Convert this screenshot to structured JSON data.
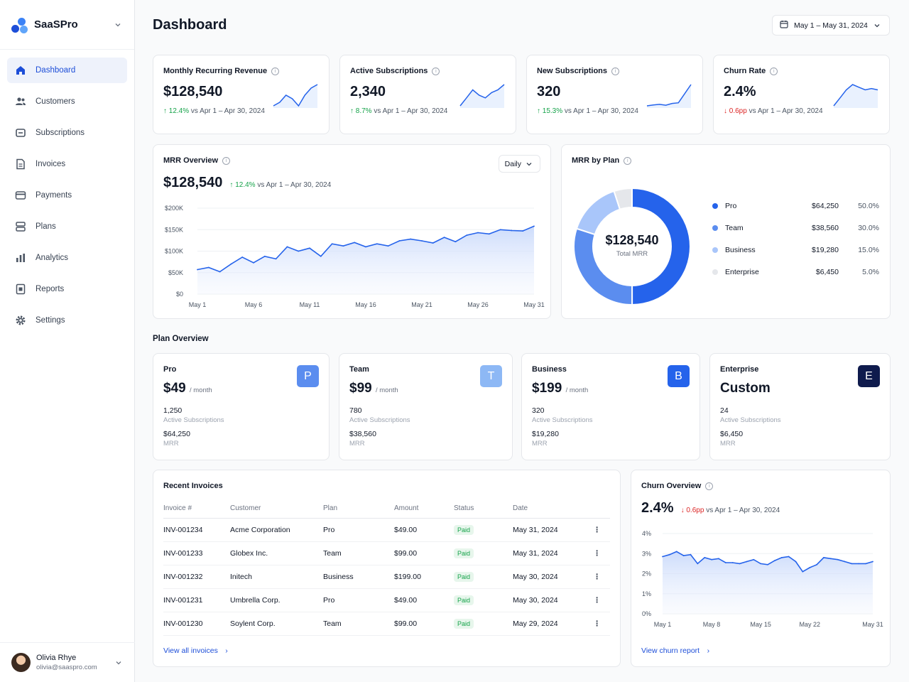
{
  "app": {
    "name": "SaaSPro"
  },
  "sidebar": {
    "items": [
      {
        "label": "Dashboard",
        "icon": "home-icon"
      },
      {
        "label": "Customers",
        "icon": "users-icon"
      },
      {
        "label": "Subscriptions",
        "icon": "subscription-icon"
      },
      {
        "label": "Invoices",
        "icon": "document-icon"
      },
      {
        "label": "Payments",
        "icon": "credit-card-icon"
      },
      {
        "label": "Plans",
        "icon": "plans-icon"
      },
      {
        "label": "Analytics",
        "icon": "bar-chart-icon"
      },
      {
        "label": "Reports",
        "icon": "report-icon"
      },
      {
        "label": "Settings",
        "icon": "gear-icon"
      }
    ],
    "user": {
      "name": "Olivia Rhye",
      "email": "olivia@saaspro.com"
    }
  },
  "header": {
    "title": "Dashboard",
    "date_range": "May 1 – May 31, 2024"
  },
  "kpis": [
    {
      "title": "Monthly Recurring Revenue",
      "value": "$128,540",
      "delta": "12.4%",
      "dir": "up",
      "compare": "vs Apr 1 – Apr 30, 2024"
    },
    {
      "title": "Active Subscriptions",
      "value": "2,340",
      "delta": "8.7%",
      "dir": "up",
      "compare": "vs Apr 1 – Apr 30, 2024"
    },
    {
      "title": "New Subscriptions",
      "value": "320",
      "delta": "15.3%",
      "dir": "up",
      "compare": "vs Apr 1 – Apr 30, 2024"
    },
    {
      "title": "Churn Rate",
      "value": "2.4%",
      "delta": "0.6pp",
      "dir": "down",
      "compare": "vs Apr 1 – Apr 30, 2024"
    }
  ],
  "mrr_overview": {
    "title": "MRR Overview",
    "period": "Daily",
    "value": "$128,540",
    "delta": "12.4%",
    "compare": "vs Apr 1 – Apr 30, 2024"
  },
  "mrr_by_plan": {
    "title": "MRR by Plan",
    "total": "$128,540",
    "total_label": "Total MRR",
    "rows": [
      {
        "name": "Pro",
        "value": "$64,250",
        "pct": "50.0%",
        "color": "#2563eb"
      },
      {
        "name": "Team",
        "value": "$38,560",
        "pct": "30.0%",
        "color": "#5b8def"
      },
      {
        "name": "Business",
        "value": "$19,280",
        "pct": "15.0%",
        "color": "#a9c6fa"
      },
      {
        "name": "Enterprise",
        "value": "$6,450",
        "pct": "5.0%",
        "color": "#e5e7eb"
      }
    ]
  },
  "plan_overview": {
    "title": "Plan Overview",
    "plans": [
      {
        "name": "Pro",
        "price": "$49",
        "per": "/ month",
        "badge": "P",
        "badge_color": "#5b8def",
        "subs": "1,250",
        "subs_label": "Active Subscriptions",
        "mrr": "$64,250",
        "mrr_label": "MRR"
      },
      {
        "name": "Team",
        "price": "$99",
        "per": "/ month",
        "badge": "T",
        "badge_color": "#8db8f5",
        "subs": "780",
        "subs_label": "Active Subscriptions",
        "mrr": "$38,560",
        "mrr_label": "MRR"
      },
      {
        "name": "Business",
        "price": "$199",
        "per": "/ month",
        "badge": "B",
        "badge_color": "#2563eb",
        "subs": "320",
        "subs_label": "Active Subscriptions",
        "mrr": "$19,280",
        "mrr_label": "MRR"
      },
      {
        "name": "Enterprise",
        "price": "Custom",
        "per": "",
        "badge": "E",
        "badge_color": "#0f1b4d",
        "subs": "24",
        "subs_label": "Active Subscriptions",
        "mrr": "$6,450",
        "mrr_label": "MRR"
      }
    ]
  },
  "invoices": {
    "title": "Recent Invoices",
    "columns": [
      "Invoice #",
      "Customer",
      "Plan",
      "Amount",
      "Status",
      "Date"
    ],
    "rows": [
      [
        "INV-001234",
        "Acme Corporation",
        "Pro",
        "$49.00",
        "Paid",
        "May 31, 2024"
      ],
      [
        "INV-001233",
        "Globex Inc.",
        "Team",
        "$99.00",
        "Paid",
        "May 31, 2024"
      ],
      [
        "INV-001232",
        "Initech",
        "Business",
        "$199.00",
        "Paid",
        "May 30, 2024"
      ],
      [
        "INV-001231",
        "Umbrella Corp.",
        "Pro",
        "$49.00",
        "Paid",
        "May 30, 2024"
      ],
      [
        "INV-001230",
        "Soylent Corp.",
        "Team",
        "$99.00",
        "Paid",
        "May 29, 2024"
      ]
    ],
    "view_all": "View all invoices"
  },
  "churn": {
    "title": "Churn Overview",
    "value": "2.4%",
    "delta": "0.6pp",
    "compare": "vs Apr 1 – Apr 30, 2024",
    "link": "View churn report"
  },
  "chart_data": [
    {
      "type": "area",
      "title": "MRR Overview",
      "x": [
        "May 1",
        "May 2",
        "May 3",
        "May 4",
        "May 5",
        "May 6",
        "May 7",
        "May 8",
        "May 9",
        "May 10",
        "May 11",
        "May 12",
        "May 13",
        "May 14",
        "May 15",
        "May 16",
        "May 17",
        "May 18",
        "May 19",
        "May 20",
        "May 21",
        "May 22",
        "May 23",
        "May 24",
        "May 25",
        "May 26",
        "May 27",
        "May 28",
        "May 29",
        "May 30",
        "May 31"
      ],
      "x_ticks": [
        "May 1",
        "May 6",
        "May 11",
        "May 16",
        "May 21",
        "May 26",
        "May 31"
      ],
      "y_ticks": [
        "$200K",
        "$150K",
        "$100K",
        "$50K",
        "$0"
      ],
      "values": [
        57000,
        62000,
        52000,
        70000,
        86000,
        73000,
        88000,
        82000,
        110000,
        100000,
        107000,
        88000,
        117000,
        112000,
        120000,
        110000,
        117000,
        112000,
        124000,
        128000,
        124000,
        119000,
        132000,
        122000,
        137000,
        143000,
        140000,
        150000,
        148000,
        147000,
        158000
      ],
      "ylim": [
        0,
        200000
      ]
    },
    {
      "type": "pie",
      "title": "MRR by Plan",
      "categories": [
        "Pro",
        "Team",
        "Business",
        "Enterprise"
      ],
      "values": [
        64250,
        38560,
        19280,
        6450
      ]
    },
    {
      "type": "area",
      "title": "Churn Overview",
      "x": [
        "May 1",
        "May 2",
        "May 3",
        "May 4",
        "May 5",
        "May 6",
        "May 7",
        "May 8",
        "May 9",
        "May 10",
        "May 11",
        "May 12",
        "May 13",
        "May 14",
        "May 15",
        "May 16",
        "May 17",
        "May 18",
        "May 19",
        "May 20",
        "May 21",
        "May 22",
        "May 23",
        "May 24",
        "May 25",
        "May 26",
        "May 27",
        "May 28",
        "May 29",
        "May 30",
        "May 31"
      ],
      "x_ticks": [
        "May 1",
        "May 8",
        "May 15",
        "May 22",
        "May 31"
      ],
      "y_ticks": [
        "4%",
        "3%",
        "2%",
        "1%",
        "0%"
      ],
      "values": [
        2.85,
        2.95,
        3.1,
        2.9,
        2.95,
        2.5,
        2.8,
        2.7,
        2.75,
        2.55,
        2.55,
        2.5,
        2.6,
        2.7,
        2.5,
        2.45,
        2.65,
        2.8,
        2.85,
        2.6,
        2.1,
        2.3,
        2.45,
        2.8,
        2.75,
        2.7,
        2.6,
        2.5,
        2.5,
        2.5,
        2.6
      ],
      "ylim": [
        0,
        4
      ]
    }
  ],
  "sparklines": [
    [
      4,
      5,
      7,
      6,
      4,
      7,
      9,
      10
    ],
    [
      2,
      5,
      8,
      6,
      5,
      7,
      8,
      10
    ],
    [
      2,
      2.3,
      2.5,
      2.2,
      2.8,
      3,
      6,
      9
    ],
    [
      2,
      5,
      8,
      10,
      9,
      8,
      8.5,
      8
    ]
  ]
}
